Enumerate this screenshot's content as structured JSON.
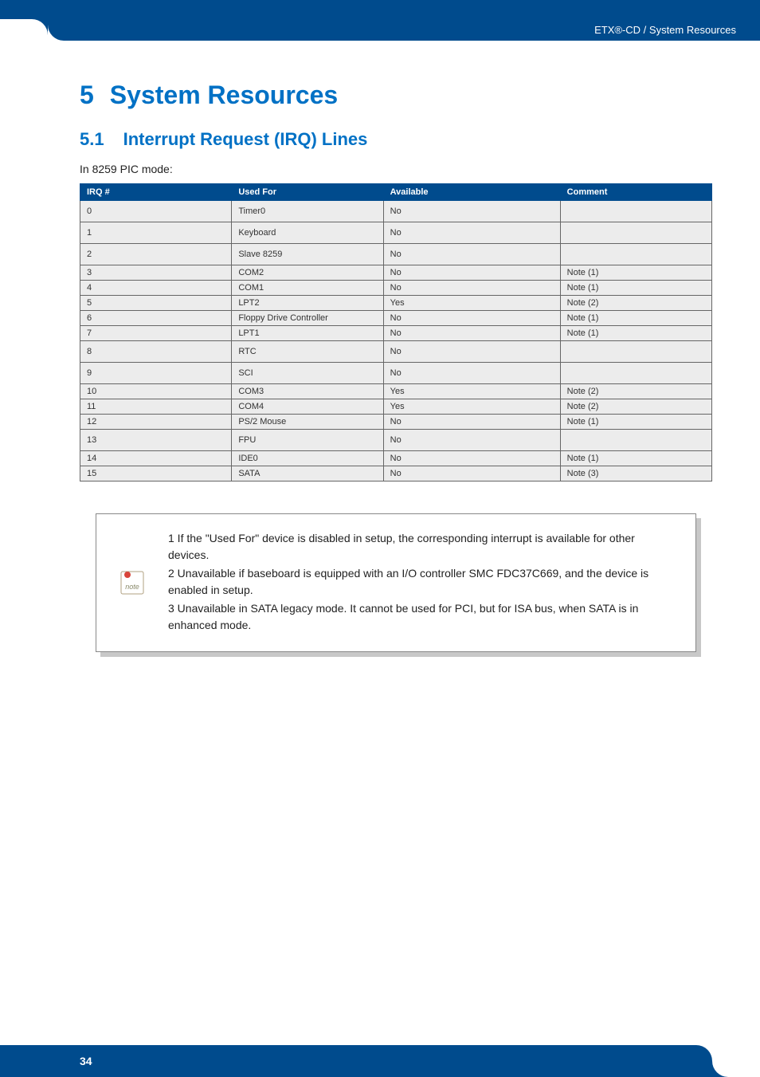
{
  "header": {
    "breadcrumb": "ETX®-CD / System Resources"
  },
  "chapter": {
    "number": "5",
    "title": "System Resources"
  },
  "section": {
    "number": "5.1",
    "title": "Interrupt Request (IRQ) Lines"
  },
  "intro": "In 8259 PIC mode:",
  "table": {
    "headers": [
      "IRQ #",
      "Used For",
      "Available",
      "Comment"
    ],
    "rows": [
      {
        "irq": "0",
        "used": "Timer0",
        "avail": "No",
        "comment": "",
        "tall": true
      },
      {
        "irq": "1",
        "used": "Keyboard",
        "avail": "No",
        "comment": "",
        "tall": true
      },
      {
        "irq": "2",
        "used": "Slave 8259",
        "avail": "No",
        "comment": "",
        "tall": true
      },
      {
        "irq": "3",
        "used": "COM2",
        "avail": "No",
        "comment": "Note (1)",
        "tall": false
      },
      {
        "irq": "4",
        "used": "COM1",
        "avail": "No",
        "comment": "Note (1)",
        "tall": false
      },
      {
        "irq": "5",
        "used": "LPT2",
        "avail": "Yes",
        "comment": "Note (2)",
        "tall": false
      },
      {
        "irq": "6",
        "used": "Floppy Drive Controller",
        "avail": "No",
        "comment": "Note (1)",
        "tall": false
      },
      {
        "irq": "7",
        "used": "LPT1",
        "avail": "No",
        "comment": "Note (1)",
        "tall": false
      },
      {
        "irq": "8",
        "used": "RTC",
        "avail": "No",
        "comment": "",
        "tall": true
      },
      {
        "irq": "9",
        "used": "SCI",
        "avail": "No",
        "comment": "",
        "tall": true
      },
      {
        "irq": "10",
        "used": "COM3",
        "avail": "Yes",
        "comment": "Note (2)",
        "tall": false
      },
      {
        "irq": "11",
        "used": "COM4",
        "avail": "Yes",
        "comment": "Note (2)",
        "tall": false
      },
      {
        "irq": "12",
        "used": "PS/2 Mouse",
        "avail": "No",
        "comment": "Note (1)",
        "tall": false
      },
      {
        "irq": "13",
        "used": "FPU",
        "avail": "No",
        "comment": "",
        "tall": true
      },
      {
        "irq": "14",
        "used": "IDE0",
        "avail": "No",
        "comment": "Note (1)",
        "tall": false
      },
      {
        "irq": "15",
        "used": "SATA",
        "avail": "No",
        "comment": "Note (3)",
        "tall": false
      }
    ]
  },
  "notes": {
    "n1": "1 If the \"Used For\" device is disabled in setup, the corresponding interrupt is available for other devices.",
    "n2": " 2 Unavailable if baseboard is equipped with an I/O controller SMC FDC37C669, and the device is enabled in setup.",
    "n3": " 3 Unavailable in SATA legacy mode. It cannot be used for PCI, but for ISA bus, when SATA is in enhanced mode."
  },
  "footer": {
    "page": "34"
  }
}
